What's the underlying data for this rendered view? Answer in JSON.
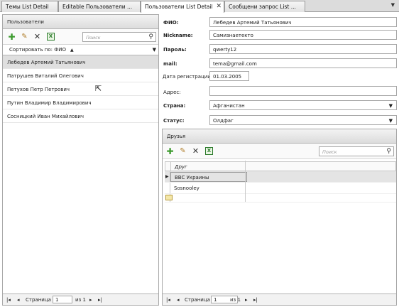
{
  "tabs": [
    {
      "label": "Темы List Detail",
      "active": false
    },
    {
      "label": "Editable Пользователи ...",
      "active": false
    },
    {
      "label": "Пользователи List Detail",
      "active": true
    },
    {
      "label": "Сообщени запрос List ...",
      "active": false
    }
  ],
  "tabs_close": "✕",
  "tabs_dropdown": "▼",
  "left": {
    "title": "Пользователи",
    "search_placeholder": "Поиск",
    "sort_label": "Сортировать по: ФИО",
    "sort_dir": "▲",
    "users": [
      "Лебедев Артемий Татьянович",
      "Патрушев Виталий Олегович",
      "Петухов Петр Петрович",
      "Путин Владимир Владимирович",
      "Сосницкий Иван Михайлович"
    ],
    "pager": {
      "page_label": "Страница",
      "page": "1",
      "of_label": "из 1"
    }
  },
  "form": {
    "fio_label": "ФИО:",
    "fio_value": "Лебедев Артемий Татьянович",
    "nick_label": "Nickname:",
    "nick_value": "Самизнаетекто",
    "pass_label": "Пароль:",
    "pass_value": "qwerty12",
    "mail_label": "mail:",
    "mail_value": "tema@gmail.com",
    "date_label": "Дата регистрации:",
    "date_value": "01.03.2005",
    "addr_label": "Адрес:",
    "addr_value": "",
    "country_label": "Страна:",
    "country_value": "Афганистан",
    "status_label": "Статус:",
    "status_value": "Олдфаг"
  },
  "friends": {
    "title": "Друзья",
    "search_placeholder": "Поиск",
    "col_header": "Друг",
    "rows": [
      "BBC Украины",
      "Sosnooley"
    ],
    "pager": {
      "page_label": "Страница",
      "page": "1",
      "of_label": "из 1"
    }
  },
  "icons": {
    "plus": "✚",
    "pencil": "✎",
    "delete": "✕",
    "excel": "X",
    "search": "⚲",
    "first": "|◂",
    "prev": "◂",
    "next": "▸",
    "last": "▸|",
    "row_pointer": "▶",
    "cursor": "⇱"
  }
}
